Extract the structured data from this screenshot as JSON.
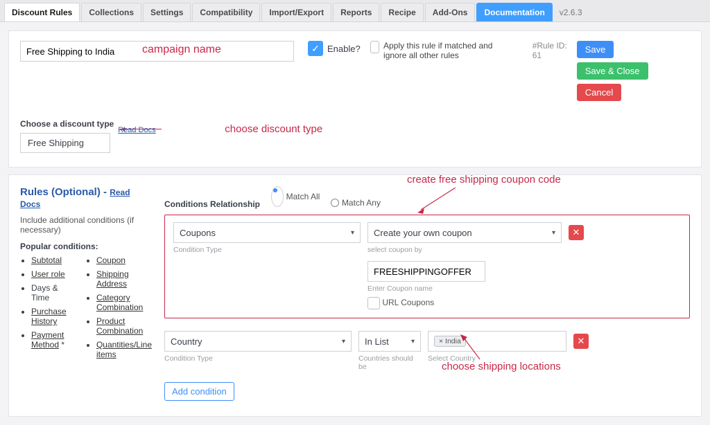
{
  "tabs": {
    "items": [
      "Discount Rules",
      "Collections",
      "Settings",
      "Compatibility",
      "Import/Export",
      "Reports",
      "Recipe",
      "Add-Ons",
      "Documentation"
    ],
    "version": "v2.6.3"
  },
  "rule": {
    "campaign_value": "Free Shipping to India",
    "enable_label": "Enable?",
    "apply_label": "Apply this rule if matched and ignore all other rules",
    "ruleid_label": "#Rule ID:",
    "ruleid_value": "61",
    "save": "Save",
    "save_close": "Save & Close",
    "cancel": "Cancel",
    "choose_label": "Choose a discount type",
    "discount_type": "Free Shipping",
    "read_docs": "Read Docs"
  },
  "annotations": {
    "campaign": "campaign name",
    "discount": "choose discount type",
    "coupon": "create free shipping coupon code",
    "location": "choose shipping locations"
  },
  "rules_panel": {
    "title": "Rules (Optional)",
    "read_docs": "Read Docs",
    "subtitle": "Include additional conditions (if necessary)",
    "popular_head": "Popular conditions:",
    "popular_col1": [
      "Subtotal",
      "User role",
      "Days & Time",
      "Purchase History",
      "Payment Method"
    ],
    "popular_col2": [
      "Coupon",
      "Shipping Address",
      "Category Combination",
      "Product Combination",
      "Quantities/Line items"
    ]
  },
  "conditions": {
    "relationship_label": "Conditions Relationship",
    "match_all": "Match All",
    "match_any": "Match Any",
    "cond1": {
      "type": "Coupons",
      "type_lab": "Condition Type",
      "mode": "Create your own coupon",
      "mode_lab": "select coupon by",
      "coupon_value": "FREESHIPPINGOFFER",
      "coupon_lab": "Enter Coupon name",
      "url_coupons": "URL Coupons"
    },
    "cond2": {
      "type": "Country",
      "type_lab": "Condition Type",
      "op": "In List",
      "op_lab": "Countries should be",
      "tag": "× India",
      "placeholder": "Select Country"
    },
    "add_condition": "Add condition"
  }
}
